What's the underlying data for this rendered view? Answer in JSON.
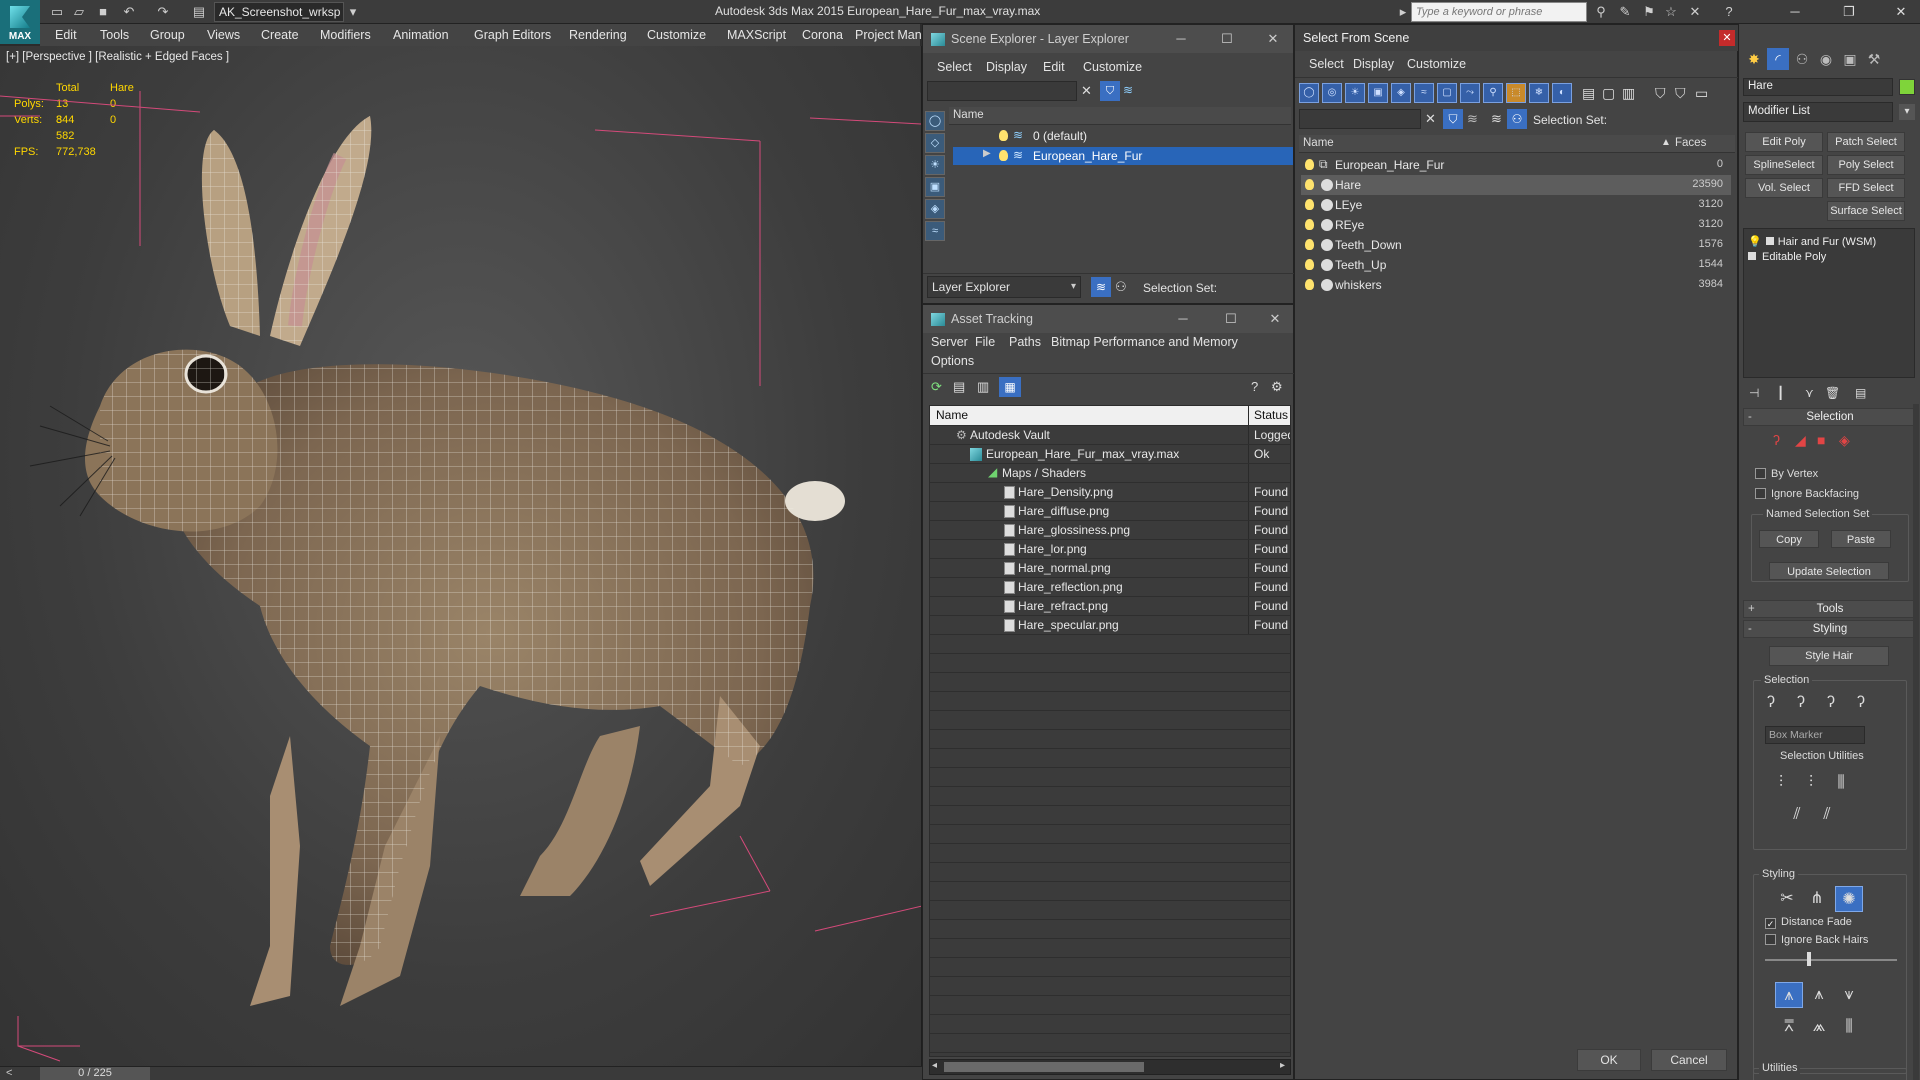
{
  "titlebar": {
    "logo": "MAX",
    "workspace": "AK_Screenshot_wrksp",
    "app_title": "Autodesk 3ds Max  2015     European_Hare_Fur_max_vray.max",
    "search_placeholder": "Type a keyword or phrase"
  },
  "menu": [
    "Edit",
    "Tools",
    "Group",
    "Views",
    "Create",
    "Modifiers",
    "Animation",
    "Graph Editors",
    "Rendering",
    "Customize",
    "MAXScript",
    "Corona",
    "Project Man"
  ],
  "viewport": {
    "label": "[+] [Perspective ] [Realistic + Edged Faces ]",
    "stats": {
      "col_total": "Total",
      "col_object": "Hare",
      "polys_label": "Polys:",
      "polys_total": "13 344",
      "polys_object": "0",
      "verts_label": "Verts:",
      "verts_total": "8 582",
      "verts_object": "0",
      "fps_label": "FPS:",
      "fps_value": "772,738"
    },
    "frame": "0 / 225"
  },
  "scene_explorer": {
    "title": "Scene Explorer - Layer Explorer",
    "menu": [
      "Select",
      "Display",
      "Edit",
      "Customize"
    ],
    "column_name": "Name",
    "layers": [
      {
        "name": "0 (default)",
        "selected": false
      },
      {
        "name": "European_Hare_Fur",
        "selected": true
      }
    ],
    "footer_dropdown": "Layer Explorer",
    "selection_set_label": "Selection Set:"
  },
  "asset_tracking": {
    "title": "Asset Tracking",
    "menu": [
      "Server",
      "File",
      "Paths",
      "Bitmap Performance and Memory"
    ],
    "menu2": "Options",
    "col_name": "Name",
    "col_status": "Status",
    "rows": [
      {
        "name": "Autodesk Vault",
        "status": "Logged",
        "indent": 0
      },
      {
        "name": "European_Hare_Fur_max_vray.max",
        "status": "Ok",
        "indent": 1
      },
      {
        "name": "Maps / Shaders",
        "status": "",
        "indent": 2
      },
      {
        "name": "Hare_Density.png",
        "status": "Found",
        "indent": 3
      },
      {
        "name": "Hare_diffuse.png",
        "status": "Found",
        "indent": 3
      },
      {
        "name": "Hare_glossiness.png",
        "status": "Found",
        "indent": 3
      },
      {
        "name": "Hare_lor.png",
        "status": "Found",
        "indent": 3
      },
      {
        "name": "Hare_normal.png",
        "status": "Found",
        "indent": 3
      },
      {
        "name": "Hare_reflection.png",
        "status": "Found",
        "indent": 3
      },
      {
        "name": "Hare_refract.png",
        "status": "Found",
        "indent": 3
      },
      {
        "name": "Hare_specular.png",
        "status": "Found",
        "indent": 3
      }
    ]
  },
  "select_from_scene": {
    "title": "Select From Scene",
    "menu": [
      "Select",
      "Display",
      "Customize"
    ],
    "selection_set_label": "Selection Set:",
    "col_name": "Name",
    "col_faces": "Faces",
    "objects": [
      {
        "name": "European_Hare_Fur",
        "faces": "0",
        "highlight": false
      },
      {
        "name": "Hare",
        "faces": "23590",
        "highlight": true
      },
      {
        "name": "LEye",
        "faces": "3120",
        "highlight": false
      },
      {
        "name": "REye",
        "faces": "3120",
        "highlight": false
      },
      {
        "name": "Teeth_Down",
        "faces": "1576",
        "highlight": false
      },
      {
        "name": "Teeth_Up",
        "faces": "1544",
        "highlight": false
      },
      {
        "name": "whiskers",
        "faces": "3984",
        "highlight": false
      }
    ],
    "ok": "OK",
    "cancel": "Cancel"
  },
  "command_panel": {
    "object_name": "Hare",
    "object_color": "#7fd43a",
    "modifier_list": "Modifier List",
    "quick_buttons": [
      "Edit Poly",
      "Patch Select",
      "SplineSelect",
      "Poly Select",
      "Vol. Select",
      "FFD Select",
      "Surface Select"
    ],
    "stack": [
      "Hair and Fur (WSM)",
      "Editable Poly"
    ],
    "selection_rollout": "Selection",
    "by_vertex": "By Vertex",
    "ignore_backfacing": "Ignore Backfacing",
    "named_sel_set": "Named Selection Set",
    "copy": "Copy",
    "paste": "Paste",
    "update_selection": "Update Selection",
    "tools_rollout": "Tools",
    "styling_rollout": "Styling",
    "style_hair": "Style Hair",
    "sel_group": "Selection",
    "box_marker": "Box Marker",
    "sel_utilities": "Selection Utilities",
    "styling_group": "Styling",
    "distance_fade": "Distance Fade",
    "ignore_back_hairs": "Ignore Back Hairs",
    "utilities": "Utilities"
  }
}
